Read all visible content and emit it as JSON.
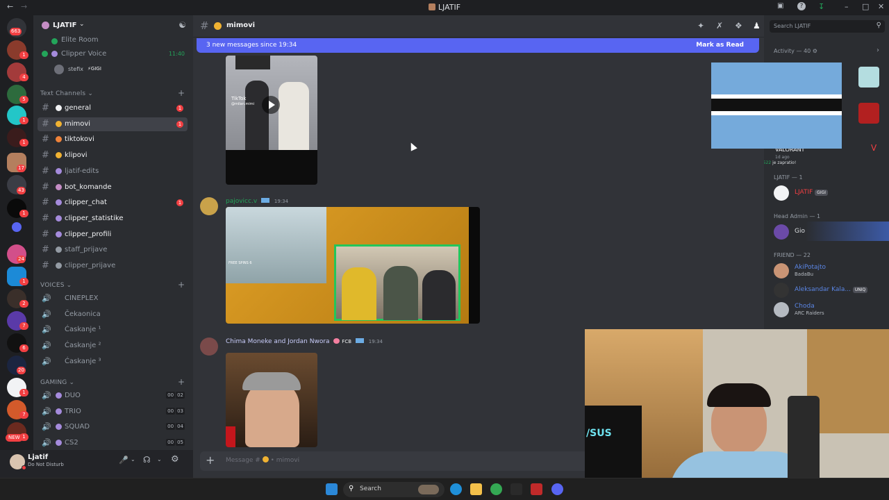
{
  "window": {
    "title": "LJATIF"
  },
  "rail": {
    "badges": [
      "663",
      "1",
      "4",
      "5",
      "1",
      "1",
      "17",
      "43",
      "1",
      "24",
      "1",
      "2",
      "7",
      "6",
      "20",
      "1",
      "7",
      "1",
      "33",
      "7",
      "NEW"
    ]
  },
  "server": {
    "name": "LJATIF",
    "top_items": [
      {
        "label": "Elite Room"
      },
      {
        "label": "Clipper Voice",
        "time": "11:40"
      }
    ],
    "voice_user": {
      "name": "stefix",
      "tag": "GIGI"
    }
  },
  "categories": {
    "text": "Text Channels",
    "voices": "VOICES",
    "gaming": "GAMING"
  },
  "text_channels": [
    {
      "label": "general",
      "badge": "1",
      "unread": true,
      "color": "#f2f3f5"
    },
    {
      "label": "mimovi",
      "badge": "1",
      "active": true,
      "color": "#f0b232"
    },
    {
      "label": "tiktokovi",
      "unread": true,
      "color": "#f0833a"
    },
    {
      "label": "klipovi",
      "unread": true,
      "color": "#f0b232"
    },
    {
      "label": "ljatif-edits",
      "color": "#a58bdc"
    },
    {
      "label": "bot_komande",
      "unread": true,
      "color": "#c58dc5"
    },
    {
      "label": "clipper_chat",
      "badge": "1",
      "unread": true,
      "color": "#a58bdc"
    },
    {
      "label": "clipper_statistike",
      "unread": true,
      "color": "#a58bdc"
    },
    {
      "label": "clipper_profili",
      "unread": true,
      "color": "#a58bdc"
    },
    {
      "label": "staff_prijave",
      "color": "#949ba4"
    },
    {
      "label": "clipper_prijave",
      "color": "#949ba4"
    }
  ],
  "voice_channels": [
    {
      "label": "CINEPLEX"
    },
    {
      "label": "Čekaonica"
    },
    {
      "label": "Ćaskanje ¹"
    },
    {
      "label": "Ćaskanje ²"
    },
    {
      "label": "Ćaskanje ³"
    }
  ],
  "gaming_channels": [
    {
      "label": "DUO",
      "c1": "00",
      "c2": "02"
    },
    {
      "label": "TRIO",
      "c1": "00",
      "c2": "03"
    },
    {
      "label": "SQUAD",
      "c1": "00",
      "c2": "04"
    },
    {
      "label": "CS2",
      "c1": "00",
      "c2": "05"
    }
  ],
  "user": {
    "name": "Ljatif",
    "status": "Do Not Disturb"
  },
  "channel_header": {
    "name": "mimovi"
  },
  "new_messages": {
    "text": "3 new messages since 19:34",
    "action": "Mark as Read"
  },
  "messages": [
    {
      "author": "pajovicc.v",
      "time": "19:34",
      "color": "#23a55a"
    },
    {
      "author": "Chima Moneke and Jordan Nwora",
      "tag": "FCB",
      "time": "19:34",
      "color": "#c9cdfb"
    }
  ],
  "first_thumb": {
    "watermark": "TikTok",
    "handle": "@milan.mimi"
  },
  "second_thumb": {
    "badge": "FREE SPINS 6"
  },
  "composer": {
    "placeholder": "Message # ",
    "channel": "mimovi"
  },
  "search": {
    "placeholder": "Search LJATIF"
  },
  "activity": {
    "label": "Activity — 40"
  },
  "activity_card": {
    "game": "VALORANT",
    "time": "1d ago",
    "note_user": "marko7522",
    "note_text": " je zapratio!"
  },
  "member_groups": [
    {
      "header": "LJATIF — 1",
      "members": [
        {
          "name": "LJATIF",
          "tag": "GIGI",
          "color": "#f23f42"
        }
      ]
    },
    {
      "header": "Head Admin — 1",
      "members": [
        {
          "name": "Gio",
          "color": "#dbdee1"
        }
      ]
    },
    {
      "header": "FRIEND — 22",
      "members": [
        {
          "name": "AkiPotajto",
          "sub": "BadaBu",
          "color": "#5b86e5"
        },
        {
          "name": "Aleksandar Kala...",
          "tag": "UNIQ",
          "color": "#5b86e5"
        },
        {
          "name": "Choda",
          "sub": "ARC Raiders",
          "color": "#5b86e5"
        }
      ]
    }
  ],
  "taskbar": {
    "search": "Search"
  },
  "colors": {
    "accent": "#5865f2",
    "danger": "#f23f42",
    "online": "#23a55a"
  }
}
